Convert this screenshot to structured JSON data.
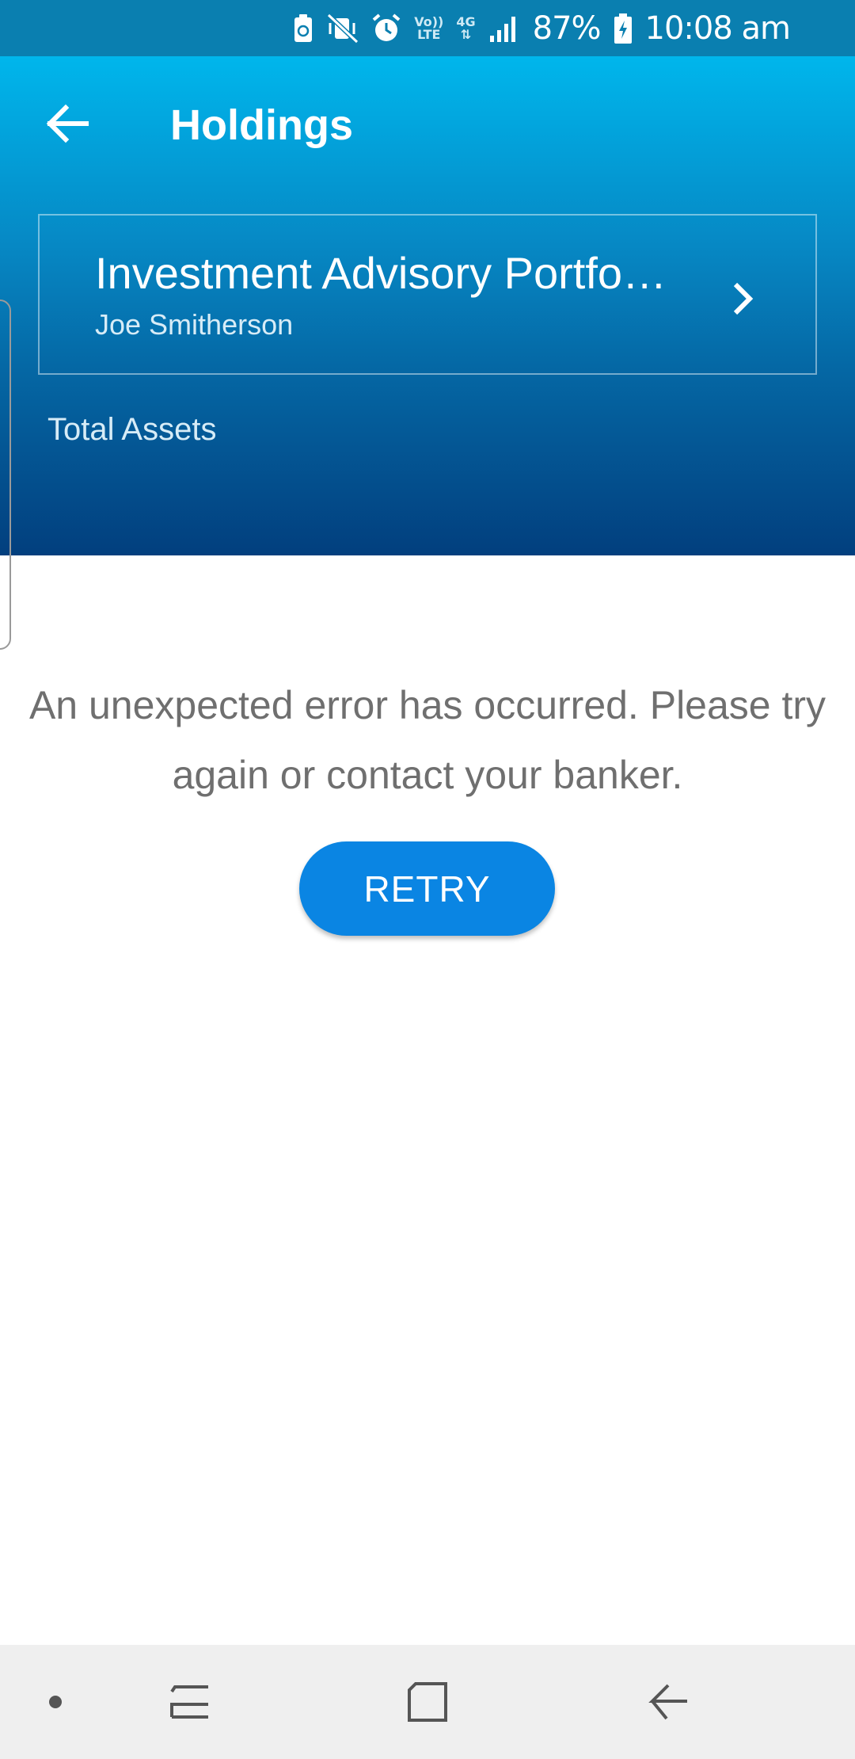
{
  "status_bar": {
    "volte_top": "Vo))",
    "volte_bottom": "LTE",
    "network_type": "4G",
    "battery": "87%",
    "time": "10:08 am",
    "icons": [
      "battery-saver-icon",
      "mute-vibrate-icon",
      "alarm-icon",
      "volte-icon",
      "data-arrows-icon",
      "signal-icon",
      "battery-charging-icon"
    ]
  },
  "header": {
    "title": "Holdings",
    "back_icon": "back-arrow-icon"
  },
  "portfolio": {
    "name": "Investment Advisory Portfo…",
    "owner": "Joe Smitherson",
    "chevron_icon": "chevron-right-icon"
  },
  "total_assets": {
    "label": "Total Assets"
  },
  "error": {
    "message": "An unexpected error has occurred. Please try again or contact your banker.",
    "retry_label": "RETRY"
  },
  "nav_bar": {
    "items": [
      "dot-icon",
      "recent-apps-icon",
      "home-icon",
      "back-icon"
    ]
  },
  "colors": {
    "status_bar": "#0a7fb0",
    "header_top": "#00b6ec",
    "header_bottom": "#023f7e",
    "retry_button": "#0a85e3",
    "error_text": "#6f6f6f",
    "nav_bar": "#efefef"
  }
}
